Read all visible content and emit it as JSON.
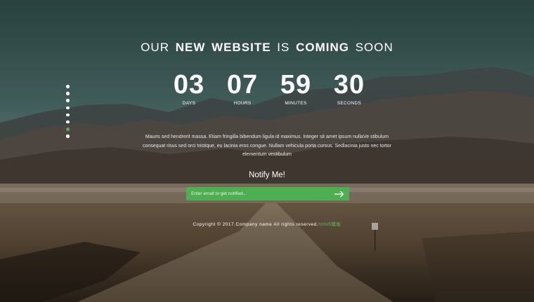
{
  "headline": {
    "w1": "OUR",
    "w2": "NEW WEBSITE",
    "w3": "IS",
    "w4": "COMING",
    "w5": "SOON"
  },
  "countdown": [
    {
      "value": "03",
      "label": "DAYS"
    },
    {
      "value": "07",
      "label": "HOURS"
    },
    {
      "value": "59",
      "label": "MINUTES"
    },
    {
      "value": "30",
      "label": "SECONDS"
    }
  ],
  "nav_dots": {
    "count": 8,
    "active_index": 6
  },
  "description": {
    "line1": "Mauris sed hendrerit massa. Etiam fringilla bibendum ligula id maximus. Integer sit amet ipsum nullaVe stibulum",
    "line2": "consequat risus sed orci tristique, eu lacinia eros congue. Nullam vehicula porta cursus. Sedlacinia justo nec tortor",
    "line3": "elementum vestibulum"
  },
  "notify": {
    "title": "Notify Me!",
    "placeholder": "Enter email to get notified...",
    "submit_icon": "arrow-right-icon"
  },
  "footer": {
    "text": "Copyright © 2017.Company name All rights reserved.",
    "link": "html5模板"
  },
  "colors": {
    "accent": "#4caf50",
    "link": "#57c15a"
  }
}
